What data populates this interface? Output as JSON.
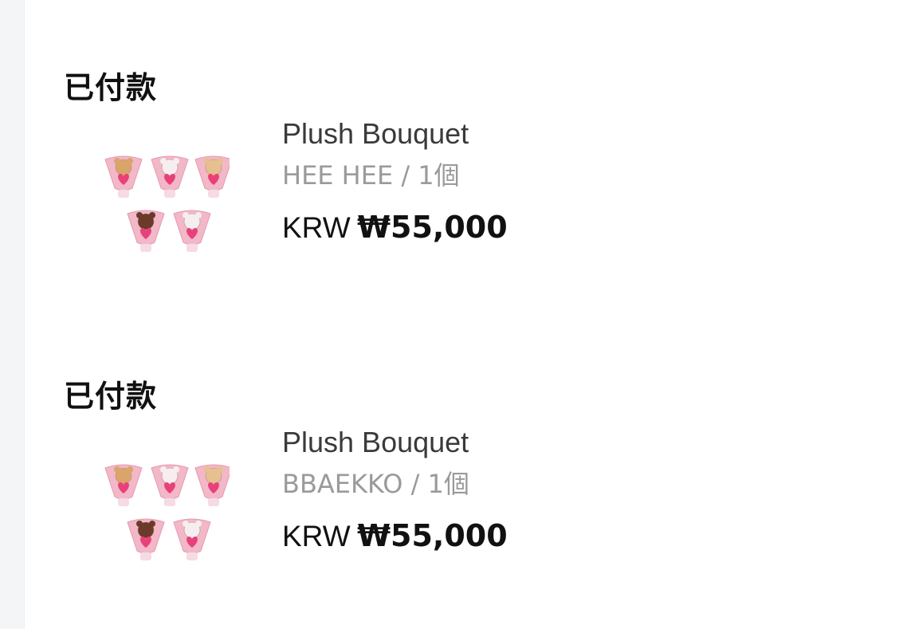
{
  "orders": [
    {
      "status": "已付款",
      "item": {
        "image_alt": "Plush Bouquet",
        "name": "Plush Bouquet",
        "variant": "HEE HEE / 1個",
        "currency": "KRW",
        "price": "₩55,000"
      }
    },
    {
      "status": "已付款",
      "item": {
        "image_alt": "Plush Bouquet",
        "name": "Plush Bouquet",
        "variant": "BBAEKKO / 1個",
        "currency": "KRW",
        "price": "₩55,000"
      }
    }
  ],
  "colors": {
    "bouquet_pink": "#f2b8c8",
    "heart_pink": "#e8407a",
    "text_dark": "#111111",
    "text_gray": "#9a9a9a"
  }
}
